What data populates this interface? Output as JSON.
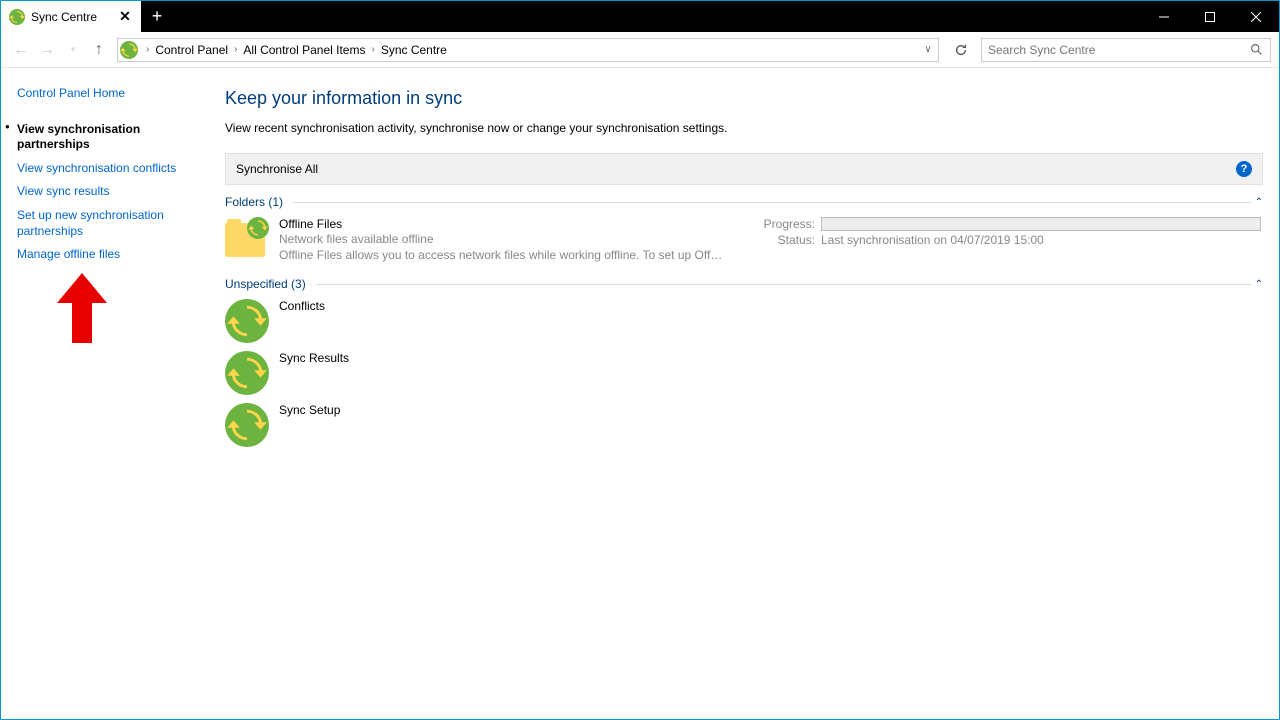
{
  "tab": {
    "title": "Sync Centre"
  },
  "breadcrumbs": [
    "Control Panel",
    "All Control Panel Items",
    "Sync Centre"
  ],
  "search": {
    "placeholder": "Search Sync Centre"
  },
  "sidebar": {
    "home": "Control Panel Home",
    "items": [
      "View synchronisation partnerships",
      "View synchronisation conflicts",
      "View sync results",
      "Set up new synchronisation partnerships",
      "Manage offline files"
    ]
  },
  "page": {
    "title": "Keep your information in sync",
    "desc": "View recent synchronisation activity, synchronise now or change your synchronisation settings."
  },
  "sync_all": "Synchronise All",
  "groups": {
    "folders": {
      "label": "Folders (1)"
    },
    "unspecified": {
      "label": "Unspecified (3)"
    }
  },
  "offline": {
    "title": "Offline Files",
    "sub1": "Network files available offline",
    "sub2": "Offline Files allows you to access network files while working offline. To set up Off…",
    "progress_label": "Progress:",
    "status_label": "Status:",
    "status_value": "Last synchronisation on 04/07/2019 15:00"
  },
  "items": {
    "conflicts": "Conflicts",
    "results": "Sync Results",
    "setup": "Sync Setup"
  }
}
